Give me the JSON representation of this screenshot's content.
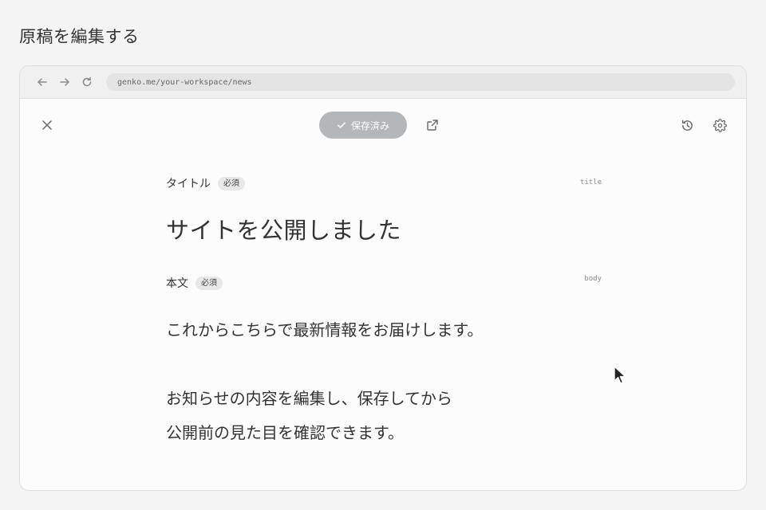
{
  "page": {
    "title": "原稿を編集する"
  },
  "browser": {
    "url": "genko.me/your-workspace/news",
    "icons": {
      "back": "arrow-left-icon",
      "forward": "arrow-right-icon",
      "reload": "reload-icon"
    }
  },
  "toolbar": {
    "saved_label": "保存済み",
    "icons": {
      "close": "close-icon",
      "saved": "check-icon",
      "open_external": "external-link-icon",
      "history": "history-icon",
      "settings": "gear-icon"
    },
    "saved_button_color": "#b4b7b9"
  },
  "fields": {
    "title": {
      "label": "タイトル",
      "required": "必須",
      "key": "title",
      "value": "サイトを公開しました"
    },
    "body": {
      "label": "本文",
      "required": "必須",
      "key": "body",
      "lines": [
        "これからこちらで最新情報をお届けします。",
        "",
        "お知らせの内容を編集し、保存してから",
        "公開前の見た目を確認できます。"
      ]
    }
  }
}
